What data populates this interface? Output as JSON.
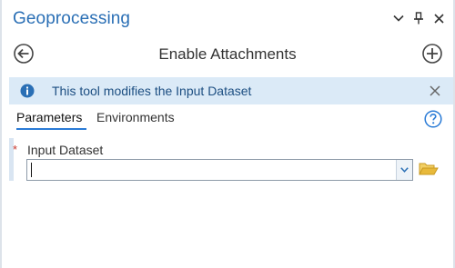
{
  "pane": {
    "title": "Geoprocessing",
    "icons": {
      "menu": "chevron-down-icon",
      "pin": "pin-icon",
      "close": "close-icon"
    }
  },
  "tool": {
    "title": "Enable Attachments",
    "back_icon": "back-arrow-icon",
    "add_icon": "add-circle-icon"
  },
  "banner": {
    "message": "This tool modifies the Input Dataset",
    "icon": "info-icon",
    "close_icon": "close-icon"
  },
  "tabs": [
    {
      "label": "Parameters",
      "active": true
    },
    {
      "label": "Environments",
      "active": false
    }
  ],
  "help_icon": "help-icon",
  "parameters": [
    {
      "label": "Input Dataset",
      "required": true,
      "required_mark": "*",
      "value": "",
      "dropdown_icon": "chevron-down-icon",
      "browse_icon": "folder-icon"
    }
  ],
  "colors": {
    "accent": "#2a6fb5",
    "banner_bg": "#dbeaf7",
    "banner_text": "#1d4f82",
    "tab_underline": "#2a7bd6",
    "required": "#c8372d",
    "folder": "#e8b93a"
  }
}
